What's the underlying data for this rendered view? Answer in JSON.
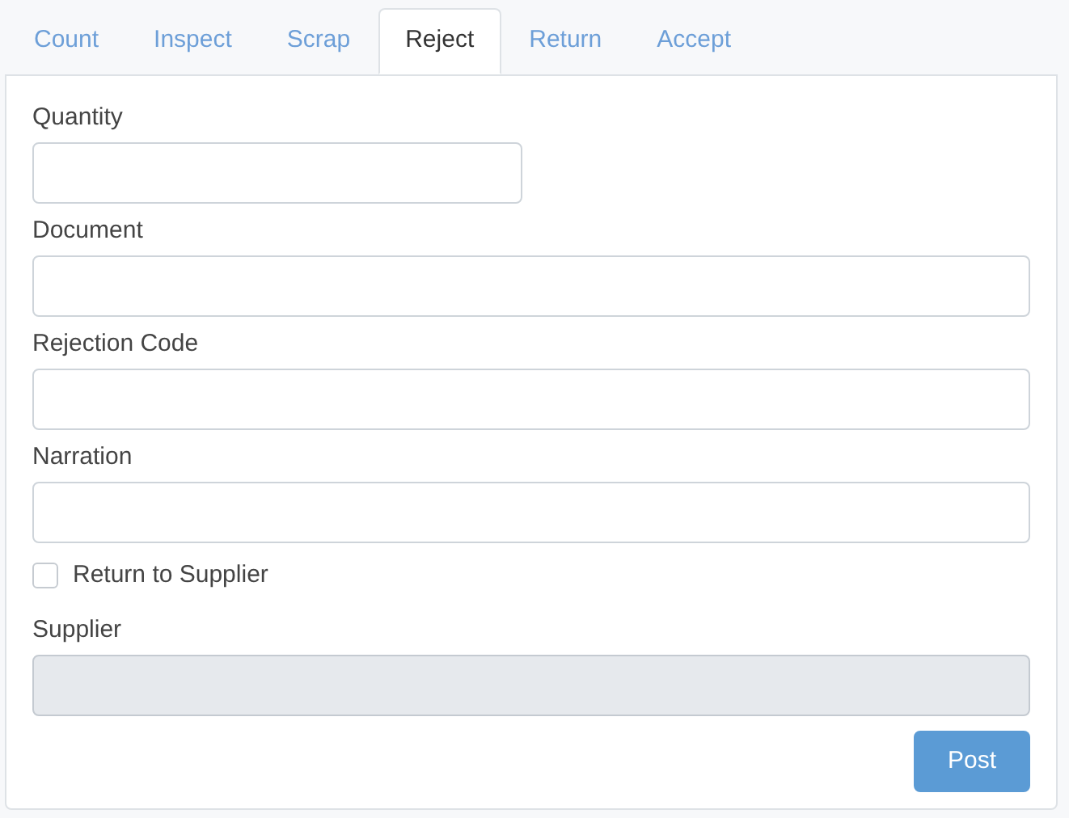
{
  "tabs": [
    {
      "label": "Count",
      "selected": false
    },
    {
      "label": "Inspect",
      "selected": false
    },
    {
      "label": "Scrap",
      "selected": false
    },
    {
      "label": "Reject",
      "selected": true
    },
    {
      "label": "Return",
      "selected": false
    },
    {
      "label": "Accept",
      "selected": false
    }
  ],
  "fields": [
    {
      "kind": "number",
      "label": "Quantity",
      "disabled": false
    },
    {
      "kind": "text",
      "label": "Document",
      "disabled": false
    },
    {
      "kind": "text",
      "label": "Rejection Code",
      "disabled": false
    },
    {
      "kind": "text",
      "label": "Narration",
      "disabled": false
    },
    {
      "kind": "checkbox",
      "label": "Return to Supplier",
      "checked": false
    },
    {
      "kind": "text",
      "label": "Supplier",
      "disabled": true
    }
  ],
  "buttons": [
    {
      "label": "Post"
    }
  ]
}
